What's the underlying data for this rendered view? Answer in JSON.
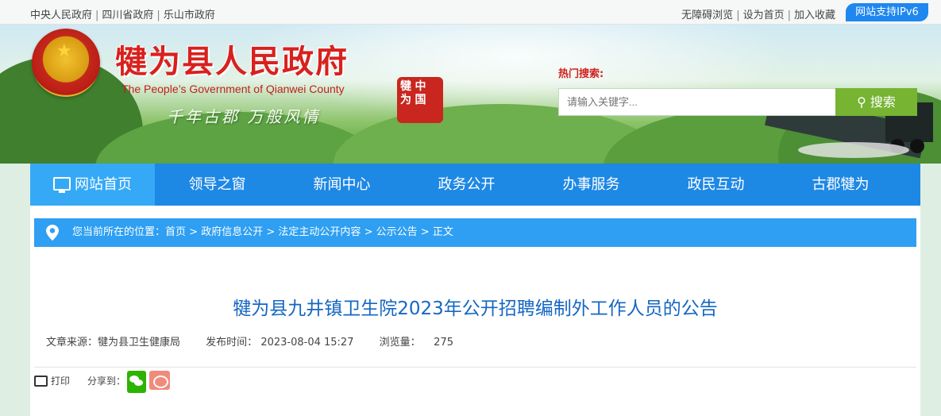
{
  "topbar": {
    "left_links": [
      "中央人民政府",
      "四川省政府",
      "乐山市政府"
    ],
    "right_links": [
      "无障碍浏览",
      "设为首页",
      "加入收藏"
    ],
    "ipv6_label": "网站支持IPv6"
  },
  "header": {
    "title": "犍为县人民政府",
    "subtitle": "The People’s Government of Qianwei County",
    "slogan": "千年古郡 万般风情",
    "seal_chars": [
      "犍",
      "中",
      "为",
      "国"
    ]
  },
  "search": {
    "label": "热门搜索:",
    "placeholder": "请输入关键字...",
    "button_label": "搜索"
  },
  "nav": {
    "items": [
      {
        "label": "网站首页"
      },
      {
        "label": "领导之窗"
      },
      {
        "label": "新闻中心"
      },
      {
        "label": "政务公开"
      },
      {
        "label": "办事服务"
      },
      {
        "label": "政民互动"
      },
      {
        "label": "古郡犍为"
      }
    ]
  },
  "breadcrumb": {
    "prefix": "您当前所在的位置：",
    "items": [
      "首页",
      "政府信息公开",
      "法定主动公开内容",
      "公示公告",
      "正文"
    ],
    "separator": ">"
  },
  "article": {
    "title": "犍为县九井镇卫生院2023年公开招聘编制外工作人员的公告",
    "source_label": "文章来源：",
    "source": "犍为县卫生健康局",
    "date_label": "发布时间：",
    "date": "2023-08-04 15:27",
    "views_label": "浏览量：",
    "views": "275"
  },
  "tools": {
    "print_label": "打印",
    "share_label": "分享到："
  },
  "colors": {
    "brand_red": "#d8211e",
    "nav_blue": "#1e88e5",
    "nav_active": "#36a9f6",
    "search_green": "#76b432",
    "title_blue": "#1667c2"
  },
  "icons": [
    "location-pin-icon",
    "monitor-icon",
    "printer-icon",
    "wechat-icon",
    "weibo-icon",
    "search-icon"
  ]
}
